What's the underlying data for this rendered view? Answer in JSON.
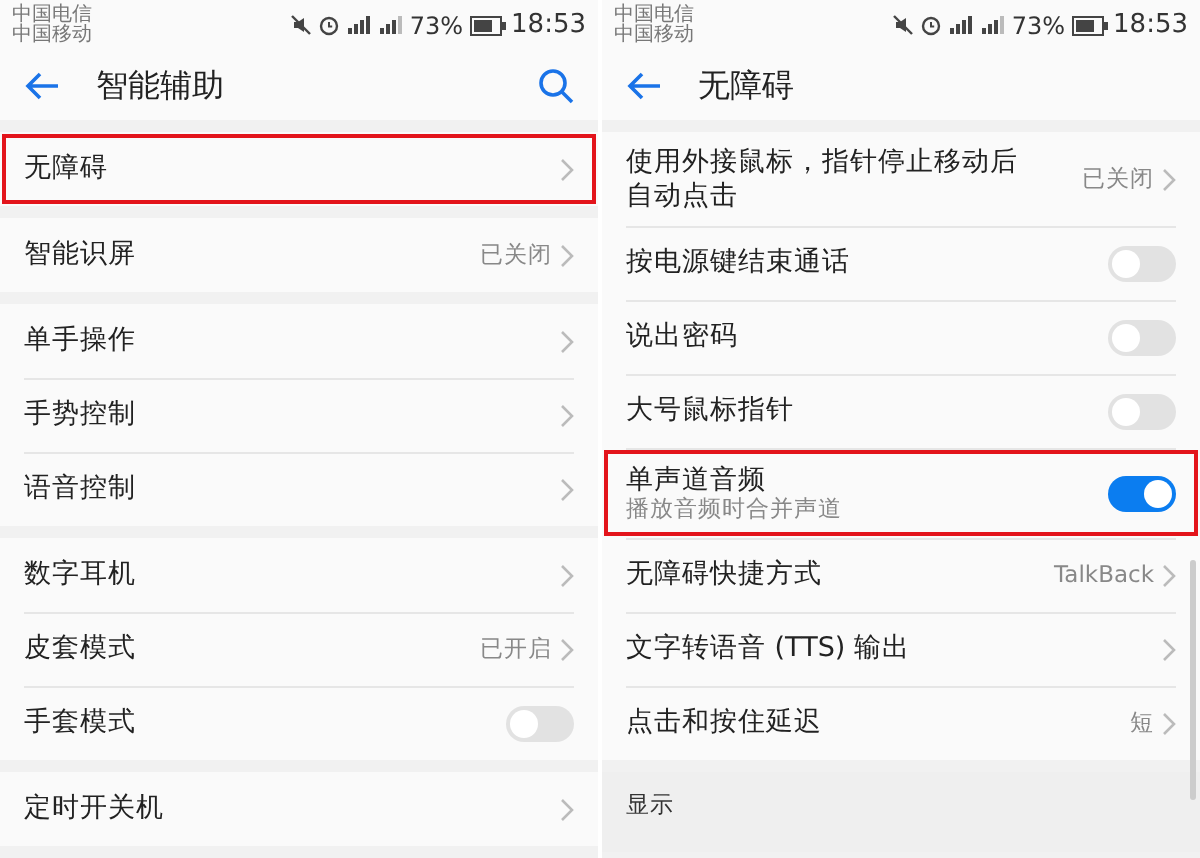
{
  "panels": [
    {
      "status_bar": {
        "carriers": [
          "中国电信",
          "中国移动"
        ],
        "battery": "73%",
        "time": "18:53"
      },
      "title": "智能辅助",
      "has_search": true,
      "sections": [
        {
          "rows": [
            {
              "kind": "link",
              "label": "无障碍",
              "highlighted": true
            }
          ]
        },
        {
          "rows": [
            {
              "kind": "link",
              "label": "智能识屏",
              "value": "已关闭",
              "highlighted": false
            }
          ]
        },
        {
          "rows": [
            {
              "kind": "link",
              "label": "单手操作",
              "highlighted": false
            },
            {
              "kind": "link",
              "label": "手势控制",
              "highlighted": false
            },
            {
              "kind": "link",
              "label": "语音控制",
              "highlighted": false
            }
          ]
        },
        {
          "rows": [
            {
              "kind": "link",
              "label": "数字耳机",
              "highlighted": false
            },
            {
              "kind": "link",
              "label": "皮套模式",
              "value": "已开启",
              "highlighted": false
            },
            {
              "kind": "switch",
              "label": "手套模式",
              "on": false,
              "highlighted": false
            }
          ]
        },
        {
          "rows": [
            {
              "kind": "link",
              "label": "定时开关机",
              "highlighted": false
            }
          ]
        }
      ]
    },
    {
      "status_bar": {
        "carriers": [
          "中国电信",
          "中国移动"
        ],
        "battery": "73%",
        "time": "18:53"
      },
      "title": "无障碍",
      "has_search": false,
      "sections": [
        {
          "rows": [
            {
              "kind": "link",
              "label": "使用外接鼠标，指针停止移动后自动点击",
              "value": "已关闭",
              "highlighted": false
            },
            {
              "kind": "switch",
              "label": "按电源键结束通话",
              "on": false,
              "highlighted": false
            },
            {
              "kind": "switch",
              "label": "说出密码",
              "on": false,
              "highlighted": false
            },
            {
              "kind": "switch",
              "label": "大号鼠标指针",
              "on": false,
              "highlighted": false
            },
            {
              "kind": "switch",
              "label": "单声道音频",
              "subtitle": "播放音频时合并声道",
              "on": true,
              "highlighted": true
            },
            {
              "kind": "link",
              "label": "无障碍快捷方式",
              "value": "TalkBack",
              "highlighted": false
            },
            {
              "kind": "link",
              "label": "文字转语音 (TTS) 输出",
              "highlighted": false
            },
            {
              "kind": "link",
              "label": "点击和按住延迟",
              "value": "短",
              "highlighted": false
            }
          ]
        },
        {
          "header": "显示"
        }
      ]
    }
  ]
}
